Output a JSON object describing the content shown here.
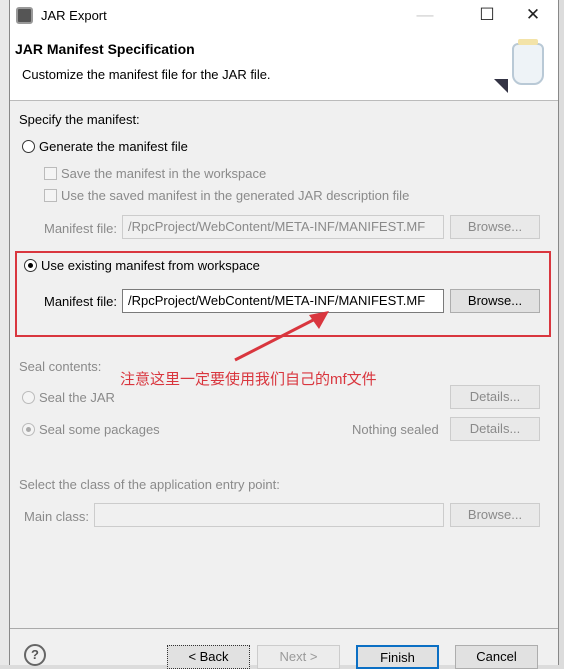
{
  "window": {
    "title": "JAR Export",
    "minimize": "—",
    "maximize": "☐",
    "close": "✕"
  },
  "header": {
    "title": "JAR Manifest Specification",
    "description": "Customize the manifest file for the JAR file."
  },
  "specify_label": "Specify the manifest:",
  "generate": {
    "label": "Generate the manifest file",
    "selected": false,
    "save_label": "Save the manifest in the workspace",
    "reuse_label": "Use the saved manifest in the generated JAR description file",
    "file_label": "Manifest file:",
    "file_value": "/RpcProject/WebContent/META-INF/MANIFEST.MF",
    "browse": "Browse..."
  },
  "existing": {
    "label": "Use existing manifest from workspace",
    "selected": true,
    "file_label": "Manifest file:",
    "file_value": "/RpcProject/WebContent/META-INF/MANIFEST.MF",
    "browse": "Browse..."
  },
  "annotation": {
    "text": "注意这里一定要使用我们自己的mf文件",
    "color": "#d9363e"
  },
  "seal": {
    "label": "Seal contents:",
    "seal_jar": "Seal the JAR",
    "seal_packages": "Seal some packages",
    "status": "Nothing sealed",
    "details1": "Details...",
    "details2": "Details..."
  },
  "entry": {
    "label": "Select the class of the application entry point:",
    "main_label": "Main class:",
    "main_value": "",
    "browse": "Browse..."
  },
  "footer": {
    "help": "?",
    "back": "< Back",
    "next": "Next >",
    "finish": "Finish",
    "cancel": "Cancel"
  }
}
